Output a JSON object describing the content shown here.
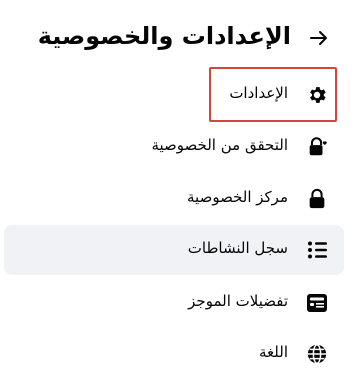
{
  "header": {
    "title": "الإعدادات والخصوصية",
    "back_icon": "arrow-right-icon"
  },
  "menu": [
    {
      "label": "الإعدادات",
      "icon": "gear-icon"
    },
    {
      "label": "التحقق من الخصوصية",
      "icon": "lock-heart-icon"
    },
    {
      "label": "مركز الخصوصية",
      "icon": "lock-icon"
    },
    {
      "label": "سجل النشاطات",
      "icon": "list-icon"
    },
    {
      "label": "تفضيلات الموجز",
      "icon": "feed-icon"
    },
    {
      "label": "اللغة",
      "icon": "globe-icon"
    }
  ],
  "colors": {
    "active_bg": "#f0f2f5",
    "highlight": "#d6453d",
    "text": "#050505"
  }
}
